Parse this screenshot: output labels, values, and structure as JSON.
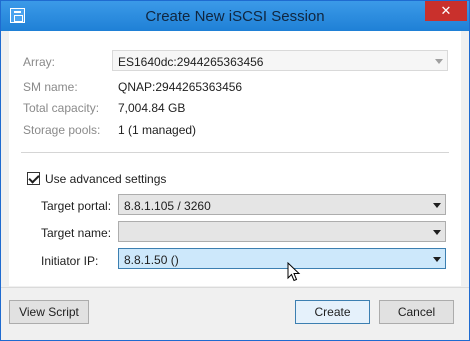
{
  "window": {
    "title": "Create New iSCSI Session",
    "close_label": "✕"
  },
  "form": {
    "array": {
      "label": "Array:",
      "value": "ES1640dc:2944265363456"
    },
    "sm_name": {
      "label": "SM name:",
      "value": "QNAP:2944265363456"
    },
    "total_capacity": {
      "label": "Total capacity:",
      "value": "7,004.84 GB"
    },
    "storage_pools": {
      "label": "Storage pools:",
      "value": "1 (1 managed)"
    }
  },
  "advanced": {
    "checkbox_label": "Use advanced settings",
    "checked": true,
    "target_portal": {
      "label": "Target portal:",
      "value": "8.8.1.105 / 3260"
    },
    "target_name": {
      "label": "Target name:",
      "value": ""
    },
    "initiator_ip": {
      "label": "Initiator IP:",
      "value": "8.8.1.50 ()"
    }
  },
  "buttons": {
    "view_script": "View Script",
    "create": "Create",
    "cancel": "Cancel"
  }
}
